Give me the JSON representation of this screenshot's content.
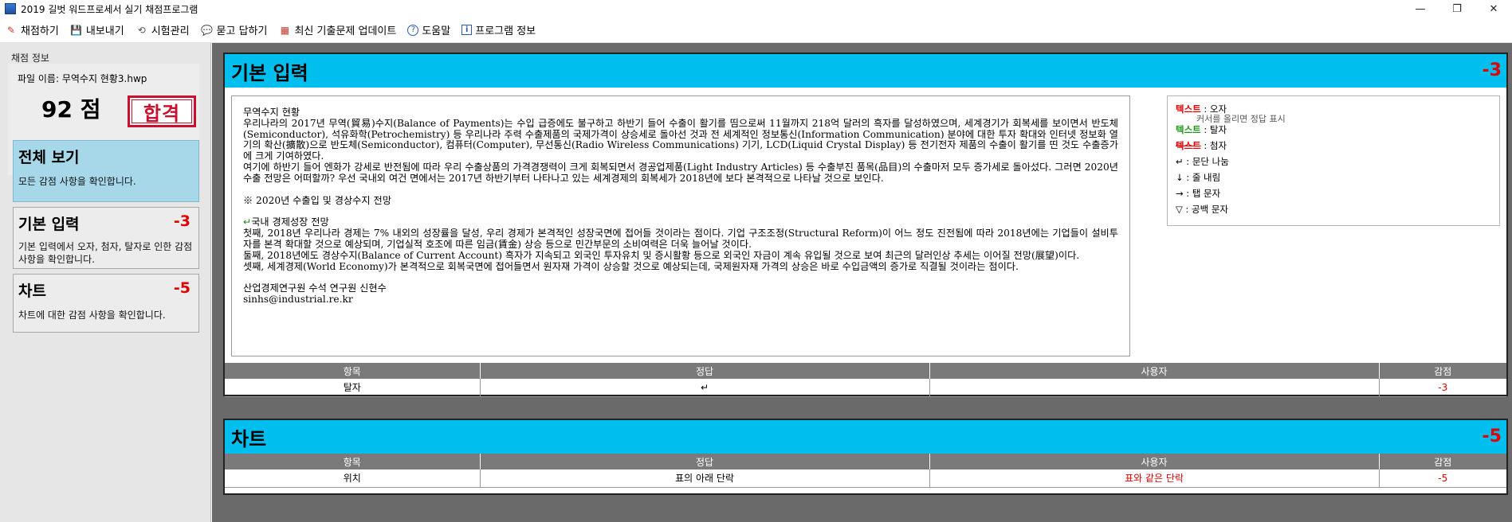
{
  "window": {
    "title": "2019 길벗 워드프로세서 실기 채점프로그램",
    "minimize": "—",
    "restore": "❐",
    "close": "✕"
  },
  "menu": [
    {
      "label": "채점하기",
      "icon": "✎"
    },
    {
      "label": "내보내기",
      "icon": "💾"
    },
    {
      "label": "시험관리",
      "icon": "⟲"
    },
    {
      "label": "묻고 답하기",
      "icon": "💬"
    },
    {
      "label": "최신 기출문제 업데이트",
      "icon": "▦"
    },
    {
      "label": "도움말",
      "icon": "?"
    },
    {
      "label": "프로그램 정보",
      "icon": "i"
    }
  ],
  "sidebar": {
    "section_title": "채점 정보",
    "file_name": "파일 이름: 무역수지 현황3.hwp",
    "score": "92 점",
    "stamp": "합격",
    "cards": [
      {
        "caption": "전체 보기",
        "deduct": "",
        "desc": "모든 감점 사항을 확인합니다."
      },
      {
        "caption": "기본 입력",
        "deduct": "-3",
        "desc": "기본 입력에서 오자, 첨자, 탈자로 인한 감점 사항을 확인합니다."
      },
      {
        "caption": "차트",
        "deduct": "-5",
        "desc": "차트에 대한 감점 사항을 확인합니다."
      }
    ]
  },
  "panels": {
    "basic": {
      "title": "기본 입력",
      "deduct": "-3",
      "doc": {
        "p1": "무역수지 현황",
        "p2": "우리나라의 2017년 무역(貿易)수지(Balance of Payments)는 수입 급증에도 불구하고 하반기 들어 수출이 활기를 띰으로써 11월까지 218억 달러의 흑자를 달성하였으며, 세계경기가 회복세를 보이면서 반도체(Semiconductor), 석유화학(Petrochemistry) 등 우리나라 주력 수출제품의 국제가격이 상승세로 돌아선 것과 전 세계적인 정보통신(Information Communication) 분야에 대한 투자 확대와 인터넷 정보화 열기의 확산(擴散)으로 반도체(Semiconductor), 컴퓨터(Computer), 무선통신(Radio Wireless Communications) 기기, LCD(Liquid Crystal Display) 등 전기전자 제품의 수출이 활기를 띤 것도 수출증가에 크게 기여하였다.",
        "p3": "여기에 하반기 들어 엔화가 강세로 반전됨에 따라 우리 수출상품의 가격경쟁력이 크게 회복되면서 경공업제품(Light Industry Articles) 등 수출부진 품목(品目)의 수출마저 모두 증가세로 돌아섰다. 그러면 2020년 수출 전망은 어떠할까? 우선 국내외 여건 면에서는 2017년 하반기부터 나타나고 있는 세계경제의 회복세가 2018년에 보다 본격적으로 나타날 것으로 보인다.",
        "p4": "※ 2020년 수출입 및 경상수지 전망",
        "p5_mark": "↵",
        "p5": "국내 경제성장 전망",
        "p6": "첫째, 2018년 우리나라 경제는 7% 내외의 성장률을 달성, 우리 경제가 본격적인 성장국면에 접어들 것이라는 점이다. 기업 구조조정(Structural Reform)이 어느 정도 진전됨에 따라 2018년에는 기업들이 설비투자를 본격 확대할 것으로 예상되며, 기업실적 호조에 따른 임금(賃金) 상승 등으로 민간부문의 소비여력은 더욱 늘어날 것이다.",
        "p7": "둘째, 2018년에도 경상수지(Balance of Current Account) 흑자가 지속되고 외국인 투자유치 및 증시활황 등으로 외국인 자금이 계속 유입될 것으로 보여 최근의 달러인상 추세는 이어질 전망(展望)이다.",
        "p8": "셋째, 세계경제(World Economy)가 본격적으로 회복국면에 접어들면서 원자재 가격이 상승할 것으로 예상되는데, 국제원자재 가격의 상승은 바로 수입금액의 증가로 직결될 것이라는 점이다.",
        "p9": "산업경제연구원 수석 연구원 신현수",
        "p10": "sinhs@industrial.re.kr"
      },
      "legend": {
        "typo_word": "텍스트",
        "typo_label": ": 오자",
        "typo_hint": "커서를 올리면 정답 표시",
        "miss_word": "텍스트",
        "miss_label": ": 탈자",
        "extra_word": "텍스트",
        "extra_label": ": 첨자",
        "para": "↵ : 문단 나눔",
        "line": "↓ : 줄 내림",
        "tab": "→ : 탭 문자",
        "space": "▽ : 공백 문자"
      },
      "table": {
        "headers": [
          "항목",
          "정답",
          "사용자",
          "감점"
        ],
        "rows": [
          {
            "item": "탈자",
            "answer": "↵",
            "user": "",
            "deduct": "-3"
          }
        ]
      }
    },
    "chart": {
      "title": "차트",
      "deduct": "-5",
      "table": {
        "headers": [
          "항목",
          "정답",
          "사용자",
          "감점"
        ],
        "rows": [
          {
            "item": "위치",
            "answer": "표의 아래 단락",
            "user": "표와 같은 단락",
            "deduct": "-5"
          }
        ]
      }
    }
  }
}
